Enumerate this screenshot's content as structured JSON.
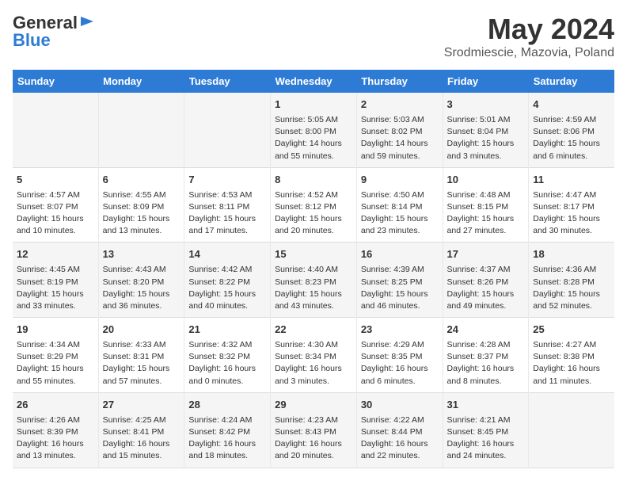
{
  "logo": {
    "line1": "General",
    "line2": "Blue"
  },
  "title": "May 2024",
  "subtitle": "Srodmiescie, Mazovia, Poland",
  "days_of_week": [
    "Sunday",
    "Monday",
    "Tuesday",
    "Wednesday",
    "Thursday",
    "Friday",
    "Saturday"
  ],
  "weeks": [
    [
      {
        "day": "",
        "content": ""
      },
      {
        "day": "",
        "content": ""
      },
      {
        "day": "",
        "content": ""
      },
      {
        "day": "1",
        "content": "Sunrise: 5:05 AM\nSunset: 8:00 PM\nDaylight: 14 hours\nand 55 minutes."
      },
      {
        "day": "2",
        "content": "Sunrise: 5:03 AM\nSunset: 8:02 PM\nDaylight: 14 hours\nand 59 minutes."
      },
      {
        "day": "3",
        "content": "Sunrise: 5:01 AM\nSunset: 8:04 PM\nDaylight: 15 hours\nand 3 minutes."
      },
      {
        "day": "4",
        "content": "Sunrise: 4:59 AM\nSunset: 8:06 PM\nDaylight: 15 hours\nand 6 minutes."
      }
    ],
    [
      {
        "day": "5",
        "content": "Sunrise: 4:57 AM\nSunset: 8:07 PM\nDaylight: 15 hours\nand 10 minutes."
      },
      {
        "day": "6",
        "content": "Sunrise: 4:55 AM\nSunset: 8:09 PM\nDaylight: 15 hours\nand 13 minutes."
      },
      {
        "day": "7",
        "content": "Sunrise: 4:53 AM\nSunset: 8:11 PM\nDaylight: 15 hours\nand 17 minutes."
      },
      {
        "day": "8",
        "content": "Sunrise: 4:52 AM\nSunset: 8:12 PM\nDaylight: 15 hours\nand 20 minutes."
      },
      {
        "day": "9",
        "content": "Sunrise: 4:50 AM\nSunset: 8:14 PM\nDaylight: 15 hours\nand 23 minutes."
      },
      {
        "day": "10",
        "content": "Sunrise: 4:48 AM\nSunset: 8:15 PM\nDaylight: 15 hours\nand 27 minutes."
      },
      {
        "day": "11",
        "content": "Sunrise: 4:47 AM\nSunset: 8:17 PM\nDaylight: 15 hours\nand 30 minutes."
      }
    ],
    [
      {
        "day": "12",
        "content": "Sunrise: 4:45 AM\nSunset: 8:19 PM\nDaylight: 15 hours\nand 33 minutes."
      },
      {
        "day": "13",
        "content": "Sunrise: 4:43 AM\nSunset: 8:20 PM\nDaylight: 15 hours\nand 36 minutes."
      },
      {
        "day": "14",
        "content": "Sunrise: 4:42 AM\nSunset: 8:22 PM\nDaylight: 15 hours\nand 40 minutes."
      },
      {
        "day": "15",
        "content": "Sunrise: 4:40 AM\nSunset: 8:23 PM\nDaylight: 15 hours\nand 43 minutes."
      },
      {
        "day": "16",
        "content": "Sunrise: 4:39 AM\nSunset: 8:25 PM\nDaylight: 15 hours\nand 46 minutes."
      },
      {
        "day": "17",
        "content": "Sunrise: 4:37 AM\nSunset: 8:26 PM\nDaylight: 15 hours\nand 49 minutes."
      },
      {
        "day": "18",
        "content": "Sunrise: 4:36 AM\nSunset: 8:28 PM\nDaylight: 15 hours\nand 52 minutes."
      }
    ],
    [
      {
        "day": "19",
        "content": "Sunrise: 4:34 AM\nSunset: 8:29 PM\nDaylight: 15 hours\nand 55 minutes."
      },
      {
        "day": "20",
        "content": "Sunrise: 4:33 AM\nSunset: 8:31 PM\nDaylight: 15 hours\nand 57 minutes."
      },
      {
        "day": "21",
        "content": "Sunrise: 4:32 AM\nSunset: 8:32 PM\nDaylight: 16 hours\nand 0 minutes."
      },
      {
        "day": "22",
        "content": "Sunrise: 4:30 AM\nSunset: 8:34 PM\nDaylight: 16 hours\nand 3 minutes."
      },
      {
        "day": "23",
        "content": "Sunrise: 4:29 AM\nSunset: 8:35 PM\nDaylight: 16 hours\nand 6 minutes."
      },
      {
        "day": "24",
        "content": "Sunrise: 4:28 AM\nSunset: 8:37 PM\nDaylight: 16 hours\nand 8 minutes."
      },
      {
        "day": "25",
        "content": "Sunrise: 4:27 AM\nSunset: 8:38 PM\nDaylight: 16 hours\nand 11 minutes."
      }
    ],
    [
      {
        "day": "26",
        "content": "Sunrise: 4:26 AM\nSunset: 8:39 PM\nDaylight: 16 hours\nand 13 minutes."
      },
      {
        "day": "27",
        "content": "Sunrise: 4:25 AM\nSunset: 8:41 PM\nDaylight: 16 hours\nand 15 minutes."
      },
      {
        "day": "28",
        "content": "Sunrise: 4:24 AM\nSunset: 8:42 PM\nDaylight: 16 hours\nand 18 minutes."
      },
      {
        "day": "29",
        "content": "Sunrise: 4:23 AM\nSunset: 8:43 PM\nDaylight: 16 hours\nand 20 minutes."
      },
      {
        "day": "30",
        "content": "Sunrise: 4:22 AM\nSunset: 8:44 PM\nDaylight: 16 hours\nand 22 minutes."
      },
      {
        "day": "31",
        "content": "Sunrise: 4:21 AM\nSunset: 8:45 PM\nDaylight: 16 hours\nand 24 minutes."
      },
      {
        "day": "",
        "content": ""
      }
    ]
  ]
}
